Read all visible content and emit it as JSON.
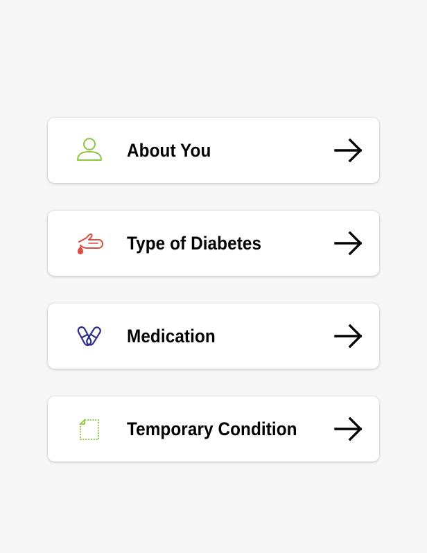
{
  "menu": {
    "items": [
      {
        "label": "About You",
        "icon": "person-icon",
        "icon_color": "#8dc63f"
      },
      {
        "label": "Type of Diabetes",
        "icon": "finger-blood-drop-icon",
        "icon_color": "#e04a3c"
      },
      {
        "label": "Medication",
        "icon": "pills-icon",
        "icon_color": "#2e2a8c"
      },
      {
        "label": "Temporary Condition",
        "icon": "document-icon",
        "icon_color": "#8dc63f"
      }
    ],
    "arrow_icon": "arrow-right-icon"
  }
}
